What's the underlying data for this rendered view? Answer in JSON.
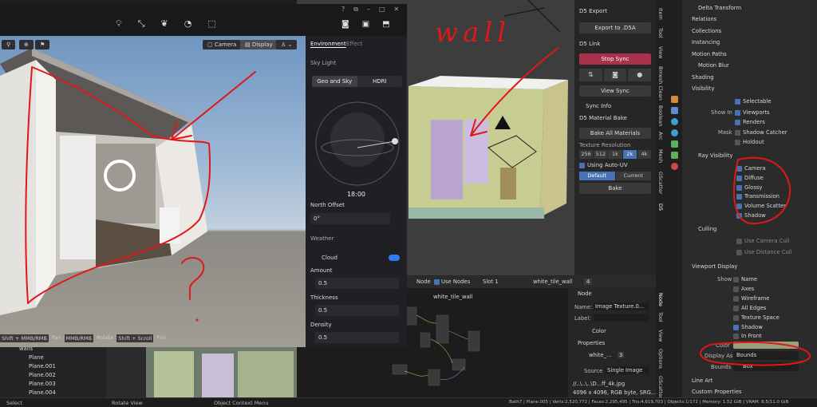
{
  "d5": {
    "toolbar_icons": [
      "bulb-icon",
      "path-icon",
      "leaf-icon",
      "time-icon",
      "cube-icon"
    ],
    "toolbar_right_icons": [
      "camera-icon",
      "image-icon",
      "box-icon"
    ],
    "window_controls": [
      "?",
      "⧉",
      "–",
      "□",
      "✕"
    ],
    "camera_label": "Camera",
    "display_label": "Display",
    "hint_pan": "Shift + MMB/RMB",
    "pan": "Pan",
    "hint_rotate": "MMB/RMB",
    "rotate": "Rotate",
    "hint_fov": "Shift + Scroll",
    "fov": "Fov",
    "tabs": {
      "environment": "Environment",
      "effect": "Effect"
    },
    "sky_light": "Sky Light",
    "seg_geo": "Geo and Sky",
    "seg_hdri": "HDRI",
    "time": "18:00",
    "north_offset": "North Offset",
    "north_value": "0°",
    "weather": "Weather",
    "cloud": "Cloud",
    "amount": "Amount",
    "amount_value": "0.5",
    "thickness": "Thickness",
    "thickness_value": "0.5",
    "density": "Density",
    "density_value": "0.5"
  },
  "plugin": {
    "d5_export": "D5 Export",
    "export_btn": "Export to .D5A",
    "d5_link": "D5 Link",
    "stop_sync": "Stop Sync",
    "view_sync": "View Sync",
    "sync_info": "Sync Info",
    "material_bake": "D5 Material Bake",
    "bake_all": "Bake All Materials",
    "texture_resolution": "Texture Resolution",
    "res": [
      "256",
      "512",
      "1k",
      "2k",
      "4k"
    ],
    "using_auto_uv": "Using Auto-UV",
    "default": "Default",
    "current": "Current",
    "bake": "Bake"
  },
  "vtabs": [
    "Item",
    "Tool",
    "View",
    "Bmesh Clean",
    "Boolean",
    "Arc",
    "Mesh",
    "GScatter",
    "D5"
  ],
  "node_editor": {
    "node_menu": "Node",
    "use_nodes": "Use Nodes",
    "slot": "Slot 1",
    "material": "white_tile_wall",
    "users": "4",
    "breadcrumb": "white_tile_wall",
    "side_node": "Node",
    "name_label": "Name:",
    "name_value": "Image Texture.0...",
    "label_label": "Label:",
    "color": "Color",
    "properties": "Properties",
    "image_name": "white_...",
    "image_users": "3",
    "source_label": "Source",
    "source_value": "Single Image",
    "path": "//..\\..\\..\\D...ff_4k.jpg",
    "info": "4096 x 4096,  RGB byte,  SRG...",
    "tabs": [
      "Node",
      "Tool",
      "View",
      "Options",
      "GScatter"
    ]
  },
  "outliner": {
    "items": [
      "walls",
      "Plane",
      "Plane.001",
      "Plane.002",
      "Plane.003",
      "Plane.004"
    ]
  },
  "properties": {
    "delta_transform": "Delta Transform",
    "relations": "Relations",
    "collections": "Collections",
    "instancing": "Instancing",
    "motion_paths": "Motion Paths",
    "motion_blur": "Motion Blur",
    "shading": "Shading",
    "visibility": "Visibility",
    "selectable": "Selectable",
    "show_in": "Show In",
    "viewports": "Viewports",
    "renders": "Renders",
    "mask": "Mask",
    "shadow_catcher": "Shadow Catcher",
    "holdout": "Holdout",
    "ray_visibility": "Ray Visibility",
    "camera": "Camera",
    "diffuse": "Diffuse",
    "glossy": "Glossy",
    "transmission": "Transmission",
    "volume_scatter": "Volume Scatter",
    "shadow": "Shadow",
    "culling": "Culling",
    "use_camera_cull": "Use Camera Cull",
    "use_distance_cull": "Use Distance Cull",
    "viewport_display": "Viewport Display",
    "show": "Show",
    "name": "Name",
    "axes": "Axes",
    "wireframe": "Wireframe",
    "all_edges": "All Edges",
    "texture_space": "Texture Space",
    "vd_shadow": "Shadow",
    "in_front": "In Front",
    "color_label": "Color",
    "display_as": "Display As",
    "display_as_value": "Bounds",
    "bounds": "Bounds",
    "bounds_value": "Box",
    "line_art": "Line Art",
    "custom_properties": "Custom Properties",
    "color_swatch": "#9aa07a"
  },
  "statusbar": {
    "select": "Select",
    "rotate_view": "Rotate View",
    "context_menu": "Object Context Menu",
    "stats": "Bath7 | Plane.005 | Verts:2,520,772 | Faces:2,295,495 | Tris:4,619,703 | Objects:1/172 | Memory: 1.52 GiB | VRAM: 8.5/11.0 GiB"
  },
  "annotation": {
    "text": "wall",
    "question": "?",
    "color": "#e01818"
  }
}
